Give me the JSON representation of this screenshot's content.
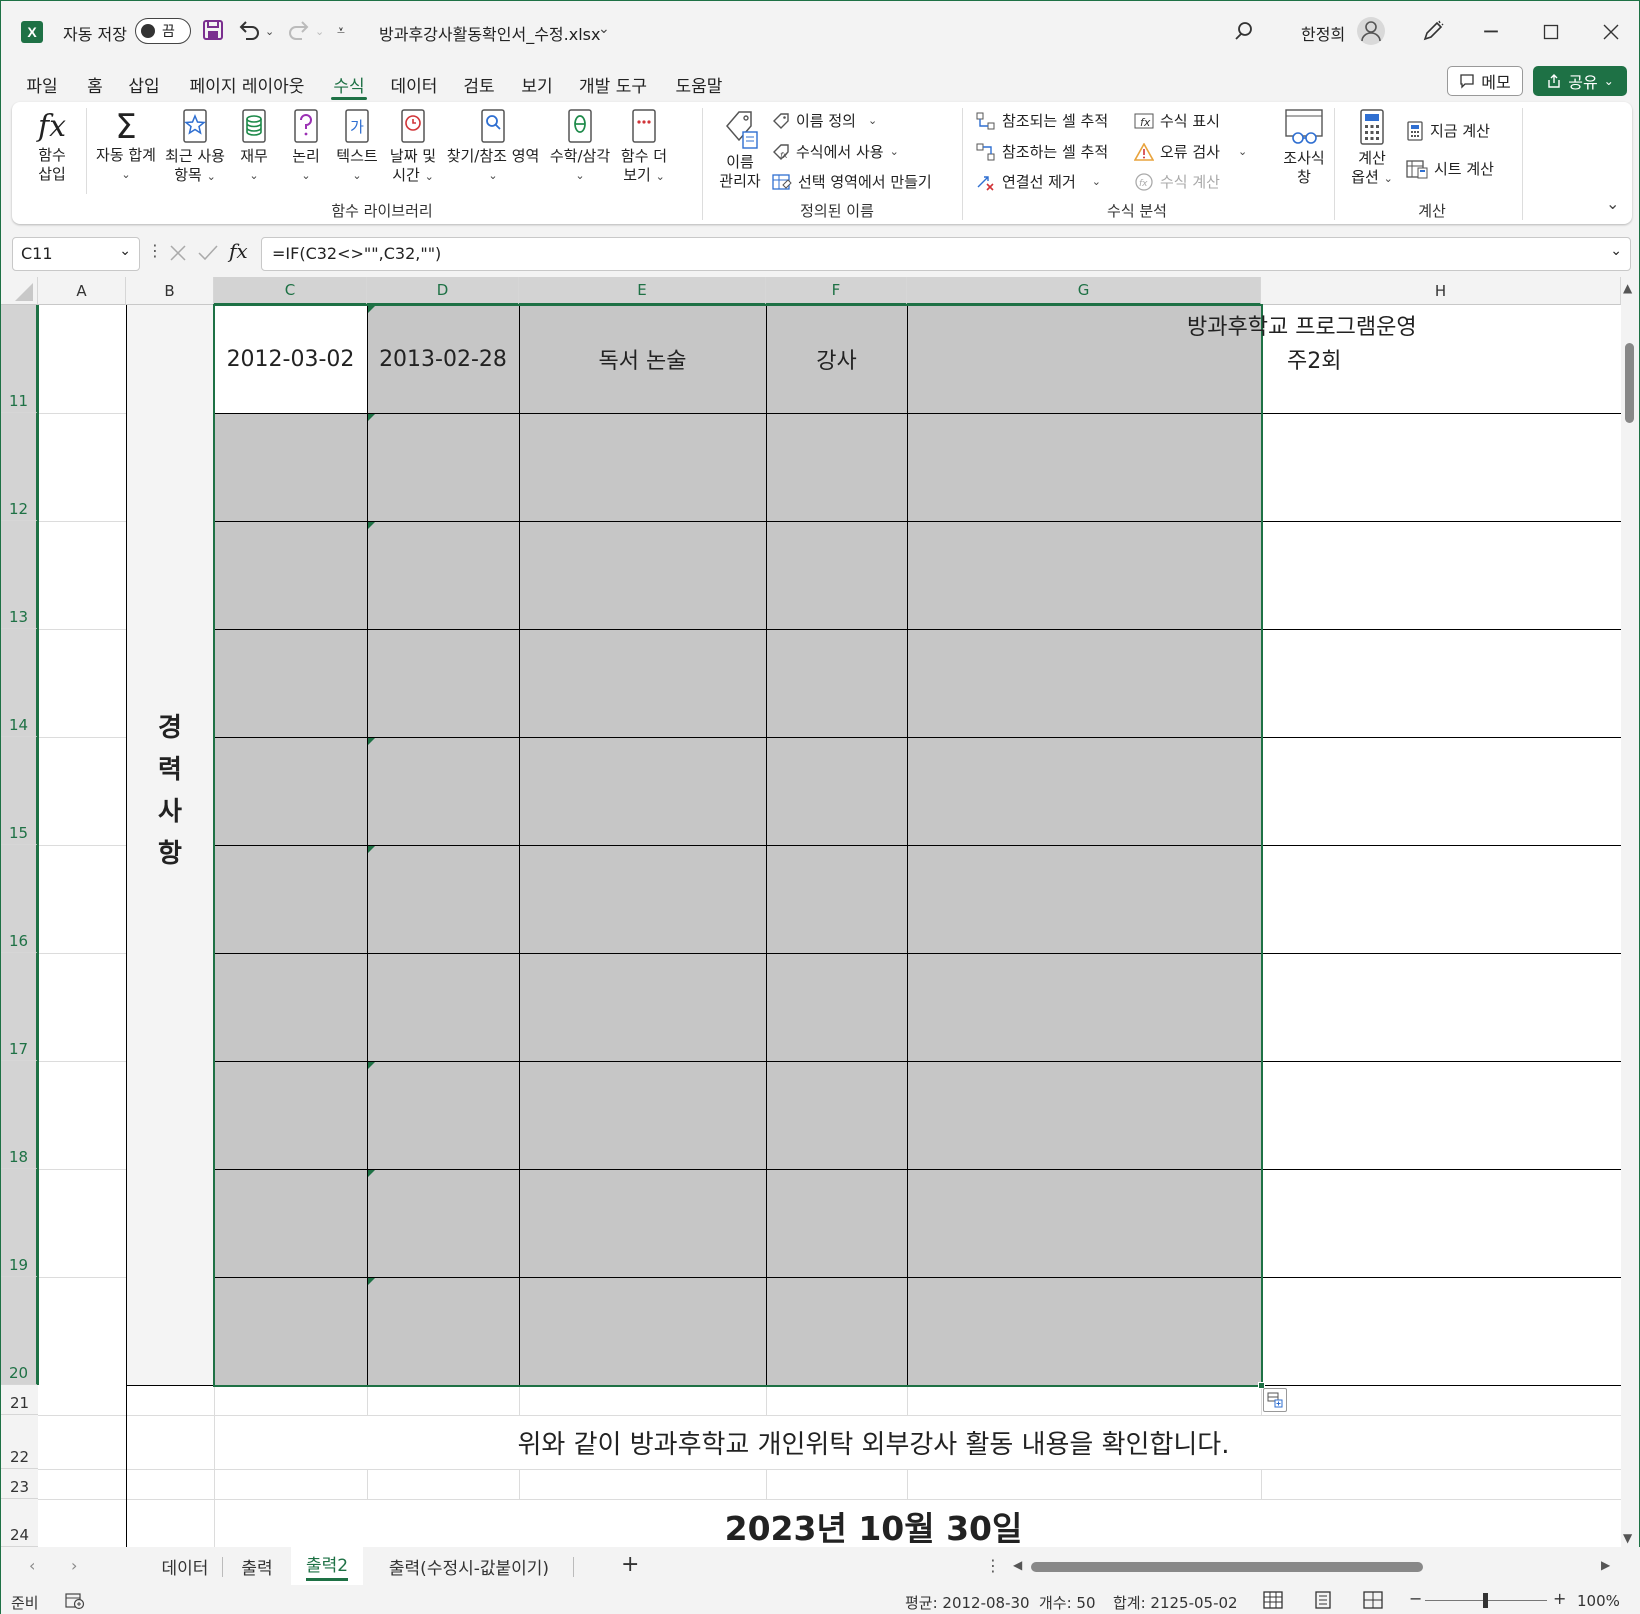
{
  "title_bar": {
    "app_icon_letter": "X",
    "autosave_label": "자동 저장",
    "autosave_state": "끔",
    "file_name": "방과후강사활동확인서_수정.xlsx",
    "user_name": "한정희"
  },
  "menu": {
    "tabs": [
      "파일",
      "홈",
      "삽입",
      "페이지 레이아웃",
      "수식",
      "데이터",
      "검토",
      "보기",
      "개발 도구",
      "도움말"
    ],
    "active": "수식",
    "memo_label": "메모",
    "share_label": "공유"
  },
  "ribbon": {
    "insert_function": [
      "함수",
      "삽입"
    ],
    "autosum": "자동 합계",
    "recent": [
      "최근 사용",
      "항목"
    ],
    "financial": "재무",
    "logical": "논리",
    "text": "텍스트",
    "datetime": [
      "날짜 및",
      "시간"
    ],
    "lookup": "찾기/참조 영역",
    "math": "수학/삼각",
    "more_functions": [
      "함수 더",
      "보기"
    ],
    "group_function_library": "함수 라이브러리",
    "name_manager": [
      "이름",
      "관리자"
    ],
    "define_name": "이름 정의",
    "use_in_formula": "수식에서 사용",
    "create_from_selection": "선택 영역에서 만들기",
    "group_defined_names": "정의된 이름",
    "trace_precedents": "참조되는 셀 추적",
    "trace_dependents": "참조하는 셀 추적",
    "remove_arrows": "연결선 제거",
    "show_formulas": "수식 표시",
    "error_checking": "오류 검사",
    "evaluate_formula": "수식 계산",
    "group_formula_auditing": "수식 분석",
    "watch_window": [
      "조사식",
      "창"
    ],
    "calc_options": [
      "계산",
      "옵션"
    ],
    "calc_now": "지금 계산",
    "calc_sheet": "시트 계산",
    "group_calculation": "계산"
  },
  "formula_bar": {
    "name_box": "C11",
    "formula": "=IF(C32<>\"\",C32,\"\")"
  },
  "grid": {
    "columns": [
      "A",
      "B",
      "C",
      "D",
      "E",
      "F",
      "G",
      "H"
    ],
    "rows": [
      "11",
      "12",
      "13",
      "14",
      "15",
      "16",
      "17",
      "18",
      "19",
      "20",
      "21",
      "22",
      "23",
      "24"
    ],
    "row11": {
      "start_date": "2012-03-02",
      "end_date": "2013-02-28",
      "program": "독서 논술",
      "role": "강사",
      "note_line1": "방과후학교 프로그램운영",
      "note_line2": "주2회"
    },
    "side_label": [
      "경",
      "력",
      "사",
      "항"
    ],
    "confirm_text": "위와 같이 방과후학교 개인위탁 외부강사 활동 내용을 확인합니다.",
    "date_text": "2023년 10월 30일"
  },
  "sheet_tabs": {
    "tabs": [
      "데이터",
      "출력",
      "출력2",
      "출력(수정시-값붙이기)"
    ],
    "active": "출력2"
  },
  "status_bar": {
    "ready": "준비",
    "average": "평균: 2012-08-30",
    "count": "개수: 50",
    "sum": "합계: 2125-05-02",
    "zoom": "100%"
  },
  "colors": {
    "excel_green": "#1e7145",
    "cell_gray": "#c6c6c6"
  }
}
